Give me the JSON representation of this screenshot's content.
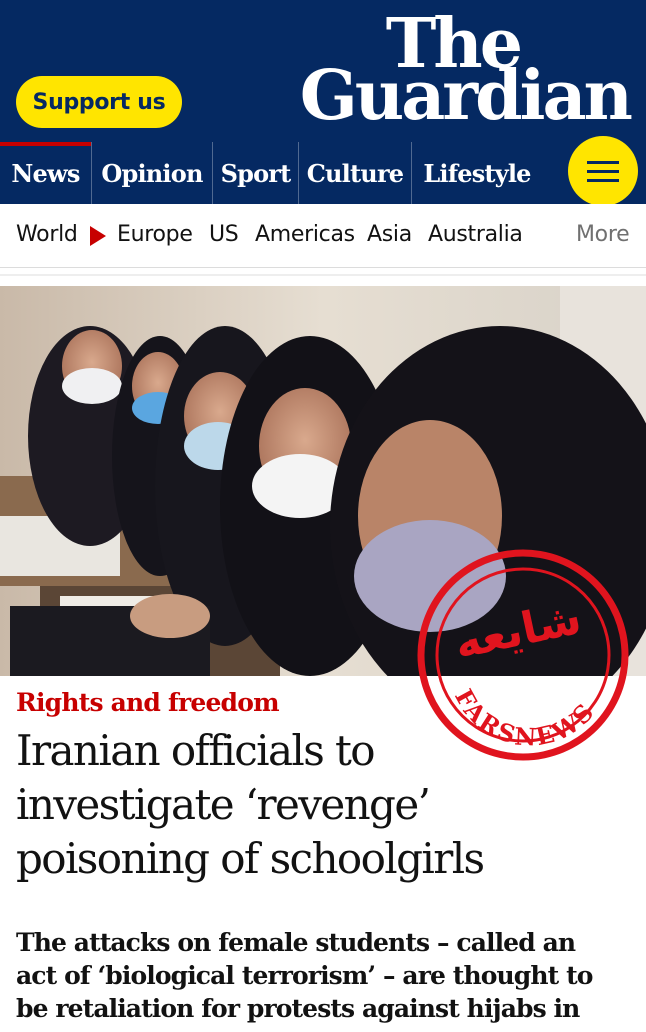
{
  "header": {
    "support_label": "Support us",
    "logo_line1": "The",
    "logo_line2": "Guardian"
  },
  "pillars": [
    "News",
    "Opinion",
    "Sport",
    "Culture",
    "Lifestyle"
  ],
  "subnav": {
    "items": [
      "World",
      "Europe",
      "US",
      "Americas",
      "Asia",
      "Australia"
    ],
    "more_label": "More"
  },
  "stamp": {
    "main_text": "شایعه",
    "ring_text": "FARSNEWS"
  },
  "article": {
    "kicker": "Rights and freedom",
    "headline_lines": [
      "Iranian officials to",
      "investigate ‘revenge’",
      "poisoning of schoolgirls"
    ],
    "standfirst_lines": [
      "The attacks on female students – called an",
      "act of ‘biological terrorism’ – are thought to",
      "be retaliation for protests against hijabs in"
    ]
  },
  "colors": {
    "brand_blue": "#052962",
    "support_yellow": "#ffe500",
    "news_red": "#c70000",
    "stamp_red": "#e0141e"
  },
  "icons": {
    "menu": "hamburger-menu-icon",
    "arrow": "red-triangle-arrow-icon"
  }
}
